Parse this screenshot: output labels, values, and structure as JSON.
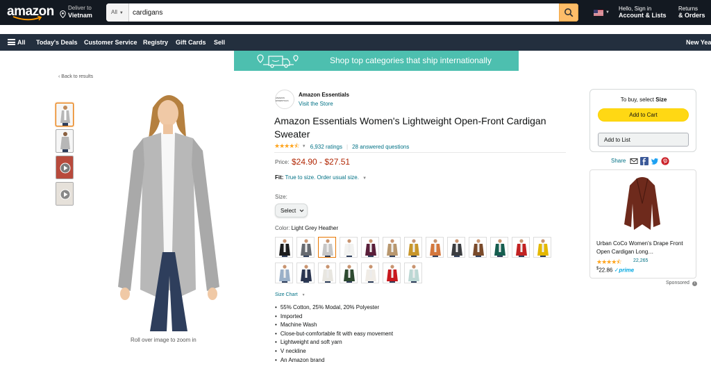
{
  "header": {
    "logo_text": "amazon",
    "deliver_line1": "Deliver to",
    "deliver_line2": "Vietnam",
    "search_category": "All",
    "search_value": "cardigans",
    "account_line1": "Hello, Sign in",
    "account_line2": "Account & Lists",
    "orders_line1": "Returns",
    "orders_line2": "& Orders"
  },
  "subnav": {
    "all": "All",
    "items": [
      "Today's Deals",
      "Customer Service",
      "Registry",
      "Gift Cards",
      "Sell"
    ],
    "promo": "New Yea"
  },
  "banner": {
    "text": "Shop top categories that ship internationally"
  },
  "back_link": "‹ Back to results",
  "zoom_caption": "Roll over image to zoom in",
  "product": {
    "brand_logo_text": "AMAZON ESSENTIALS",
    "brand": "Amazon Essentials",
    "visit_store": "Visit the Store",
    "title": "Amazon Essentials Women's Lightweight Open-Front Cardigan Sweater",
    "stars": "★★★★⯪",
    "ratings": "6,932 ratings",
    "answered": "28 answered questions",
    "price_label": "Price:",
    "price": "$24.90 - $27.51",
    "fit_label": "Fit:",
    "fit_text": "True to size. Order usual size.",
    "size_label": "Size:",
    "size_select": "Select",
    "color_label": "Color:",
    "color_value": "Light Grey Heather",
    "size_chart": "Size Chart",
    "bullets": [
      "55% Cotton, 25% Modal, 20% Polyester",
      "Imported",
      "Machine Wash",
      "Close-but-comfortable fit with easy movement",
      "Lightweight and soft yarn",
      "V neckline",
      "An Amazon brand"
    ],
    "swatch_colors": [
      "#1c1c1c",
      "#666a70",
      "#c6c6c6",
      "#f2f2f0",
      "#5a1f3a",
      "#b8976e",
      "#c8962a",
      "#d4773d",
      "#3b3d40",
      "#7a4a2a",
      "#155e4f",
      "#c22222",
      "#e4b800",
      "#9ab0c8",
      "#2a3550",
      "#e8e6e0",
      "#2e4a30",
      "#f0ece6",
      "#c8181e",
      "#bcd8d4"
    ]
  },
  "buybox": {
    "title_prefix": "To buy, select",
    "title_bold": "Size",
    "add_to_cart": "Add to Cart",
    "add_to_list": "Add to List"
  },
  "share_label": "Share",
  "ad": {
    "title": "Urban CoCo Women's Drape Front Open Cardigan Long…",
    "stars": "★★★★⯪",
    "count": "22,265",
    "price_dollar": "$",
    "price_value": "22.86",
    "prime": "✓prime"
  },
  "sponsored": "Sponsored"
}
